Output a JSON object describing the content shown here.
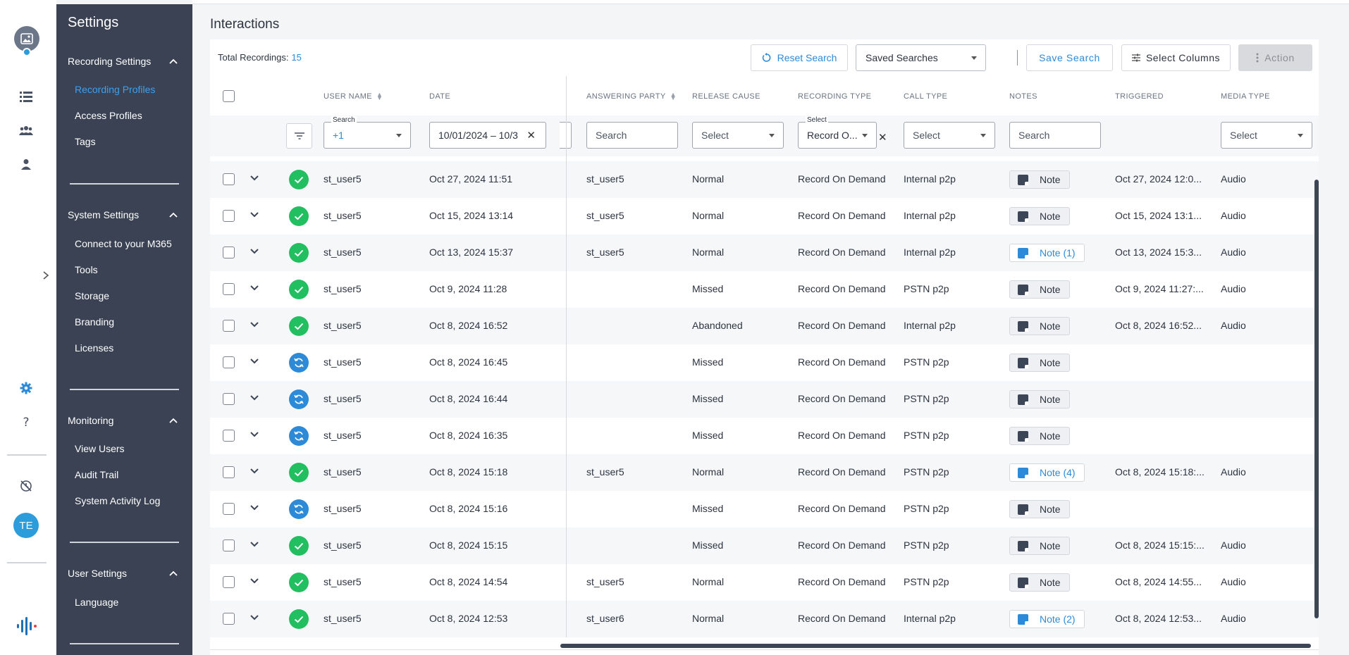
{
  "rail": {
    "user_initials": "TE",
    "icons": [
      "image-placeholder-icon",
      "list-icon",
      "group-icon",
      "person-icon",
      "gear-icon",
      "help-icon",
      "history-icon",
      "logo-icon"
    ]
  },
  "sidebar": {
    "title": "Settings",
    "sections": [
      {
        "label": "Recording Settings",
        "items": [
          "Recording Profiles",
          "Access Profiles",
          "Tags"
        ]
      },
      {
        "label": "System Settings",
        "items": [
          "Connect to your M365",
          "Tools",
          "Storage",
          "Branding",
          "Licenses"
        ]
      },
      {
        "label": "Monitoring",
        "items": [
          "View Users",
          "Audit Trail",
          "System Activity Log"
        ]
      },
      {
        "label": "User Settings",
        "items": [
          "Language"
        ]
      }
    ],
    "active_item": "Recording Profiles"
  },
  "page": {
    "title": "Interactions",
    "total_label": "Total Recordings:",
    "total_count": "15"
  },
  "toolbar": {
    "reset_search": "Reset Search",
    "saved_searches": "Saved Searches",
    "save_search": "Save Search",
    "select_columns": "Select Columns",
    "action": "Action"
  },
  "columns": {
    "user_name": "USER NAME",
    "date": "DATE",
    "answering_party": "ANSWERING PARTY",
    "release_cause": "RELEASE CAUSE",
    "recording_type": "RECORDING TYPE",
    "call_type": "CALL TYPE",
    "notes": "NOTES",
    "triggered": "TRIGGERED",
    "media_type": "MEDIA TYPE"
  },
  "filters": {
    "user_name_label": "Search",
    "user_name_value": "+1",
    "date_value": "10/01/2024 – 10/3",
    "answering_party_placeholder": "Search",
    "release_cause_value": "Select",
    "recording_type_label": "Select",
    "recording_type_value": "Record O...",
    "call_type_value": "Select",
    "notes_placeholder": "Search",
    "media_type_value": "Select"
  },
  "rows": [
    {
      "status": "ok",
      "user": "st_user5",
      "date": "Oct 27, 2024 11:51",
      "answering": "st_user5",
      "release": "Normal",
      "rectype": "Record On Demand",
      "calltype": "Internal p2p",
      "note": "Note",
      "has_note": false,
      "triggered": "Oct 27, 2024 12:0...",
      "media": "Audio"
    },
    {
      "status": "ok",
      "user": "st_user5",
      "date": "Oct 15, 2024 13:14",
      "answering": "st_user5",
      "release": "Normal",
      "rectype": "Record On Demand",
      "calltype": "Internal p2p",
      "note": "Note",
      "has_note": false,
      "triggered": "Oct 15, 2024 13:1...",
      "media": "Audio"
    },
    {
      "status": "ok",
      "user": "st_user5",
      "date": "Oct 13, 2024 15:37",
      "answering": "st_user5",
      "release": "Normal",
      "rectype": "Record On Demand",
      "calltype": "Internal p2p",
      "note": "Note (1)",
      "has_note": true,
      "triggered": "Oct 13, 2024 15:3...",
      "media": "Audio"
    },
    {
      "status": "ok",
      "user": "st_user5",
      "date": "Oct 9, 2024 11:28",
      "answering": "",
      "release": "Missed",
      "rectype": "Record On Demand",
      "calltype": "PSTN p2p",
      "note": "Note",
      "has_note": false,
      "triggered": "Oct 9, 2024 11:27:...",
      "media": "Audio"
    },
    {
      "status": "ok",
      "user": "st_user5",
      "date": "Oct 8, 2024 16:52",
      "answering": "",
      "release": "Abandoned",
      "rectype": "Record On Demand",
      "calltype": "Internal p2p",
      "note": "Note",
      "has_note": false,
      "triggered": "Oct 8, 2024 16:52...",
      "media": "Audio"
    },
    {
      "status": "sync",
      "user": "st_user5",
      "date": "Oct 8, 2024 16:45",
      "answering": "",
      "release": "Missed",
      "rectype": "Record On Demand",
      "calltype": "PSTN p2p",
      "note": "Note",
      "has_note": false,
      "triggered": "",
      "media": ""
    },
    {
      "status": "sync",
      "user": "st_user5",
      "date": "Oct 8, 2024 16:44",
      "answering": "",
      "release": "Missed",
      "rectype": "Record On Demand",
      "calltype": "PSTN p2p",
      "note": "Note",
      "has_note": false,
      "triggered": "",
      "media": ""
    },
    {
      "status": "sync",
      "user": "st_user5",
      "date": "Oct 8, 2024 16:35",
      "answering": "",
      "release": "Missed",
      "rectype": "Record On Demand",
      "calltype": "PSTN p2p",
      "note": "Note",
      "has_note": false,
      "triggered": "",
      "media": ""
    },
    {
      "status": "ok",
      "user": "st_user5",
      "date": "Oct 8, 2024 15:18",
      "answering": "st_user5",
      "release": "Normal",
      "rectype": "Record On Demand",
      "calltype": "PSTN p2p",
      "note": "Note (4)",
      "has_note": true,
      "triggered": "Oct 8, 2024 15:18:...",
      "media": "Audio"
    },
    {
      "status": "sync",
      "user": "st_user5",
      "date": "Oct 8, 2024 15:16",
      "answering": "",
      "release": "Missed",
      "rectype": "Record On Demand",
      "calltype": "PSTN p2p",
      "note": "Note",
      "has_note": false,
      "triggered": "",
      "media": ""
    },
    {
      "status": "ok",
      "user": "st_user5",
      "date": "Oct 8, 2024 15:15",
      "answering": "",
      "release": "Missed",
      "rectype": "Record On Demand",
      "calltype": "PSTN p2p",
      "note": "Note",
      "has_note": false,
      "triggered": "Oct 8, 2024 15:15:...",
      "media": "Audio"
    },
    {
      "status": "ok",
      "user": "st_user5",
      "date": "Oct 8, 2024 14:54",
      "answering": "st_user5",
      "release": "Normal",
      "rectype": "Record On Demand",
      "calltype": "PSTN p2p",
      "note": "Note",
      "has_note": false,
      "triggered": "Oct 8, 2024 14:55...",
      "media": "Audio"
    },
    {
      "status": "ok",
      "user": "st_user5",
      "date": "Oct 8, 2024 12:53",
      "answering": "st_user6",
      "release": "Normal",
      "rectype": "Record On Demand",
      "calltype": "Internal p2p",
      "note": "Note (2)",
      "has_note": true,
      "triggered": "Oct 8, 2024 12:53...",
      "media": "Audio"
    }
  ],
  "colors": {
    "sidebar_bg": "#3a4253",
    "accent": "#2d8ad8",
    "status_ok": "#22bf61",
    "status_sync": "#2d8ad8"
  }
}
